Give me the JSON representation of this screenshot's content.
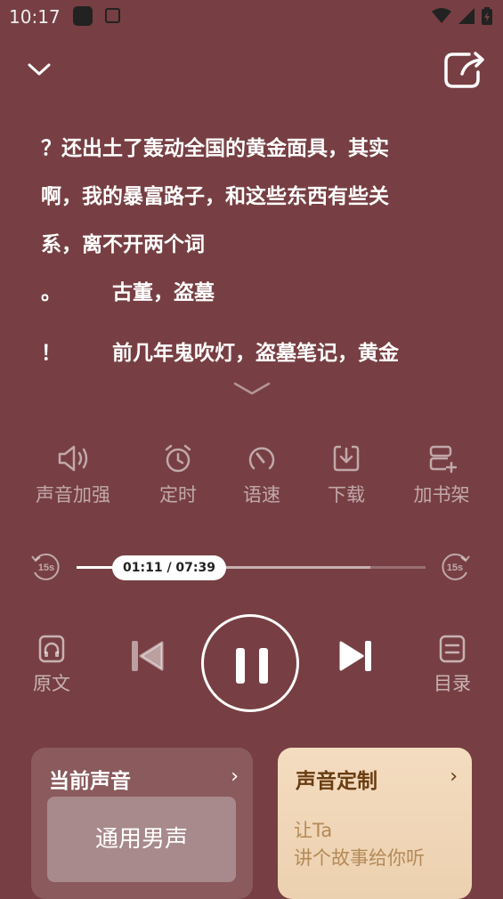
{
  "status_bar": {
    "time": "10:17",
    "app_icons": [
      "app-icon",
      "text-app-icon"
    ],
    "right_icons": [
      "wifi-icon",
      "signal-icon",
      "battery-icon"
    ]
  },
  "header": {
    "collapse_icon": "chevron-down-icon",
    "share_icon": "share-icon"
  },
  "lyrics": {
    "lines": [
      {
        "mark": "",
        "text": "？还出土了轰动全国的黄金面具，其实"
      },
      {
        "mark": "",
        "text": "啊，我的暴富路子，和这些东西有些关"
      },
      {
        "mark": "",
        "text": "系，离不开两个词"
      },
      {
        "mark": "。",
        "text": "古董，盗墓"
      },
      {
        "mark": "！",
        "text": "前几年鬼吹灯，盗墓笔记，黄金"
      }
    ],
    "expand_icon": "chevron-down-icon"
  },
  "functions": [
    {
      "icon": "speaker-icon",
      "label": "声音加强"
    },
    {
      "icon": "alarm-clock-icon",
      "label": "定时"
    },
    {
      "icon": "speed-gauge-icon",
      "label": "语速"
    },
    {
      "icon": "download-icon",
      "label": "下载"
    },
    {
      "icon": "add-bookshelf-icon",
      "label": "加书架"
    }
  ],
  "progress": {
    "rewind_label": "15s",
    "forward_label": "15s",
    "time_display": "01:11 / 07:39",
    "played_fraction": 0.155,
    "buffered_fraction": 0.84
  },
  "controls": {
    "original_text_label": "原文",
    "catalog_label": "目录",
    "play_state": "playing"
  },
  "voice_card": {
    "title": "当前声音",
    "arrow": "›",
    "voice_name": "通用男声"
  },
  "custom_card": {
    "title": "声音定制",
    "arrow": "›",
    "line1": "让Ta",
    "line2": "讲个故事给你听"
  }
}
